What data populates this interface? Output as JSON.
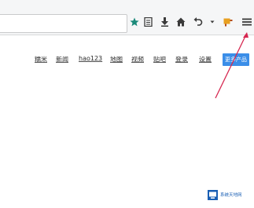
{
  "browser": {
    "url_value": "",
    "toolbar_icons": [
      "star-icon",
      "reading-list-icon",
      "download-icon",
      "home-icon",
      "back-dropdown-icon",
      "dropdown-caret-icon",
      "extension-icon",
      "menu-icon"
    ],
    "accent_color": "#3b8ee8"
  },
  "baidu_nav": {
    "links": [
      "糯米",
      "新闻",
      "hao123",
      "地图",
      "视频",
      "贴吧",
      "登录",
      "设置"
    ],
    "more_button": "更多产品"
  },
  "annotation": {
    "arrow_color": "#d62750"
  },
  "watermark": {
    "label": "系统天地网"
  }
}
